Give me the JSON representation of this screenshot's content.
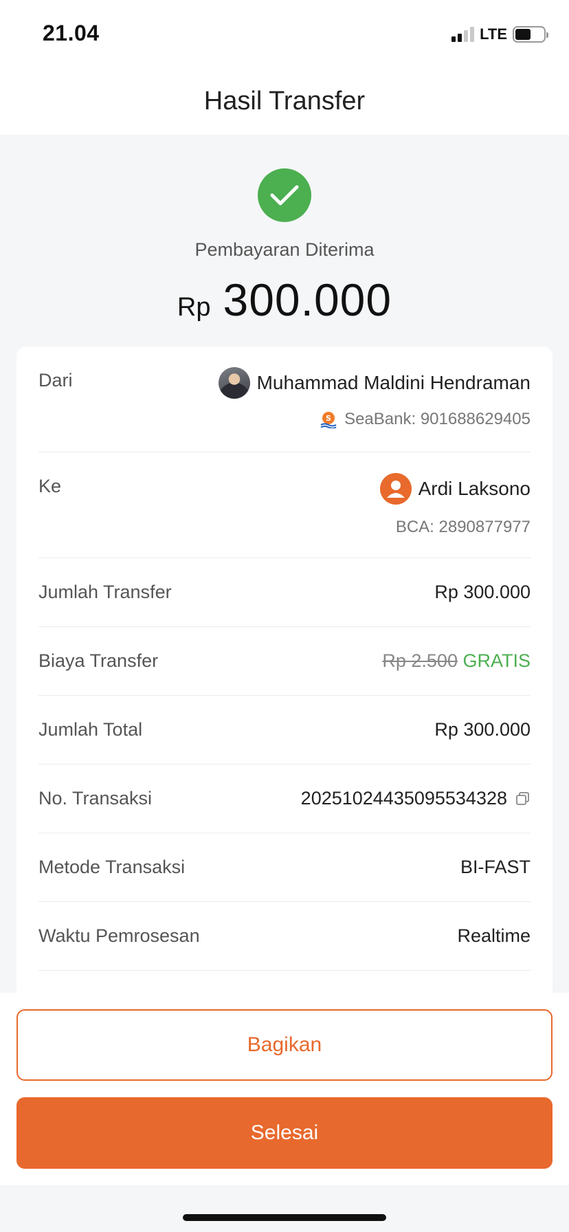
{
  "status_bar": {
    "time": "21.04",
    "network": "LTE"
  },
  "header": {
    "title": "Hasil Transfer"
  },
  "result": {
    "status_label": "Pembayaran Diterima",
    "currency": "Rp",
    "amount": "300.000",
    "status_color": "#4caf50"
  },
  "details": {
    "from": {
      "label": "Dari",
      "name": "Muhammad Maldini Hendraman",
      "account": "SeaBank: 901688629405",
      "bank_icon": "seabank-logo-icon"
    },
    "to": {
      "label": "Ke",
      "name": "Ardi Laksono",
      "account": "BCA: 2890877977"
    },
    "transfer_amount": {
      "label": "Jumlah Transfer",
      "value": "Rp 300.000"
    },
    "transfer_fee": {
      "label": "Biaya Transfer",
      "original": "Rp 2.500",
      "value": "GRATIS"
    },
    "total_amount": {
      "label": "Jumlah Total",
      "value": "Rp 300.000"
    },
    "transaction_no": {
      "label": "No. Transaksi",
      "value": "20251024435095534328"
    },
    "method": {
      "label": "Metode Transaksi",
      "value": "BI-FAST"
    },
    "processing_time": {
      "label": "Waktu Pemrosesan",
      "value": "Realtime"
    }
  },
  "actions": {
    "share_label": "Bagikan",
    "done_label": "Selesai",
    "accent_color": "#e8692d"
  }
}
